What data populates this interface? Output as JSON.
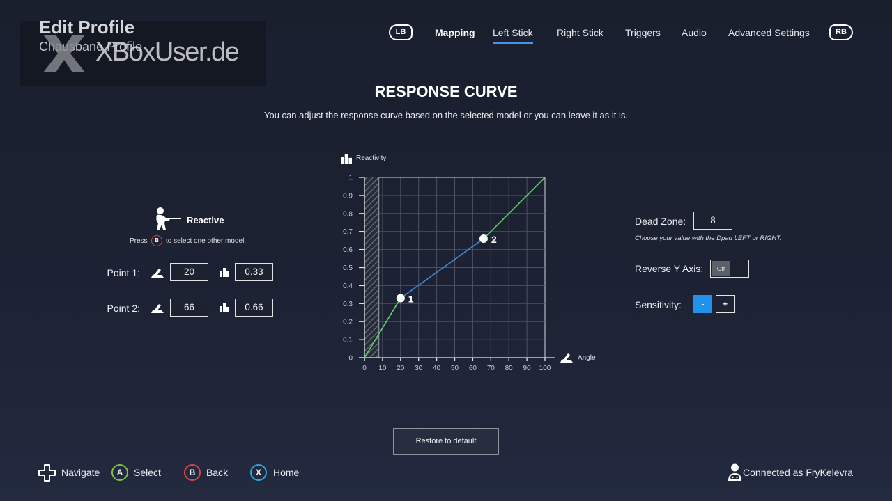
{
  "header": {
    "title": "Edit Profile",
    "subtitle": "Chausbane Profile"
  },
  "watermark": {
    "text": "XBoxUser.de"
  },
  "nav": {
    "lb": "LB",
    "rb": "RB",
    "tabs": [
      {
        "label": "Mapping"
      },
      {
        "label": "Left Stick",
        "active": true
      },
      {
        "label": "Right Stick"
      },
      {
        "label": "Triggers"
      },
      {
        "label": "Audio"
      },
      {
        "label": "Advanced Settings"
      }
    ]
  },
  "section": {
    "title": "RESPONSE CURVE",
    "description": "You can adjust the response curve based on the selected model or you can leave it as it is."
  },
  "model": {
    "icon": "shooter-icon",
    "name": "Reactive",
    "hint_prefix": "Press",
    "hint_button": "B",
    "hint_suffix": "to select one other model."
  },
  "points": [
    {
      "label": "Point 1:",
      "angle": "20",
      "reactivity": "0.33"
    },
    {
      "label": "Point 2:",
      "angle": "66",
      "reactivity": "0.66"
    }
  ],
  "settings": {
    "dead_zone": {
      "label": "Dead Zone:",
      "value": "8",
      "hint": "Choose your value with the Dpad LEFT or RIGHT."
    },
    "reverse_y": {
      "label": "Reverse Y Axis:",
      "value": "Off"
    },
    "sensitivity": {
      "label": "Sensitivity:",
      "decrease": "-",
      "increase": "+"
    }
  },
  "restore_button": "Restore to default",
  "footer": {
    "hints": [
      {
        "icon": "dpad-icon",
        "label": "Navigate"
      },
      {
        "button": "A",
        "label": "Select",
        "color": "#7cc243"
      },
      {
        "button": "B",
        "label": "Back",
        "color": "#e2433f"
      },
      {
        "button": "X",
        "label": "Home",
        "color": "#2ea7e0"
      }
    ],
    "connected": "Connected as FryKelevra"
  },
  "colors": {
    "accent": "#2092ec",
    "tab_underline": "#4b93e8"
  },
  "chart_data": {
    "type": "line",
    "ylabel": "Reactivity",
    "xlabel": "Angle",
    "xlim": [
      0,
      100
    ],
    "ylim": [
      0,
      1
    ],
    "x_ticks": [
      0,
      10,
      20,
      30,
      40,
      50,
      60,
      70,
      80,
      90,
      100
    ],
    "y_ticks": [
      0,
      0.1,
      0.2,
      0.3,
      0.4,
      0.5,
      0.6,
      0.7,
      0.8,
      0.9,
      1
    ],
    "grid": true,
    "points": [
      {
        "x": 0,
        "y": 0
      },
      {
        "x": 20,
        "y": 0.33,
        "label": "1"
      },
      {
        "x": 66,
        "y": 0.66,
        "label": "2"
      },
      {
        "x": 100,
        "y": 1
      }
    ],
    "segment_colors": [
      "#5fd46a",
      "#3b8ddb",
      "#5fd46a"
    ]
  }
}
